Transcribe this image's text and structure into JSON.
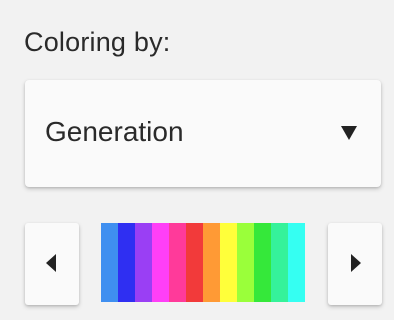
{
  "coloring": {
    "heading": "Coloring by:",
    "selected": "Generation"
  },
  "palette": {
    "colors": [
      "#3f8ff0",
      "#2f2ff2",
      "#9a3ff4",
      "#ff3ff7",
      "#ff3a9a",
      "#f23a3a",
      "#ff9a35",
      "#ffff3a",
      "#9aff3a",
      "#35e83a",
      "#35f29a",
      "#35fff2"
    ]
  },
  "icons": {
    "dropdown": "caret-down-icon",
    "prev": "caret-left-icon",
    "next": "caret-right-icon"
  }
}
